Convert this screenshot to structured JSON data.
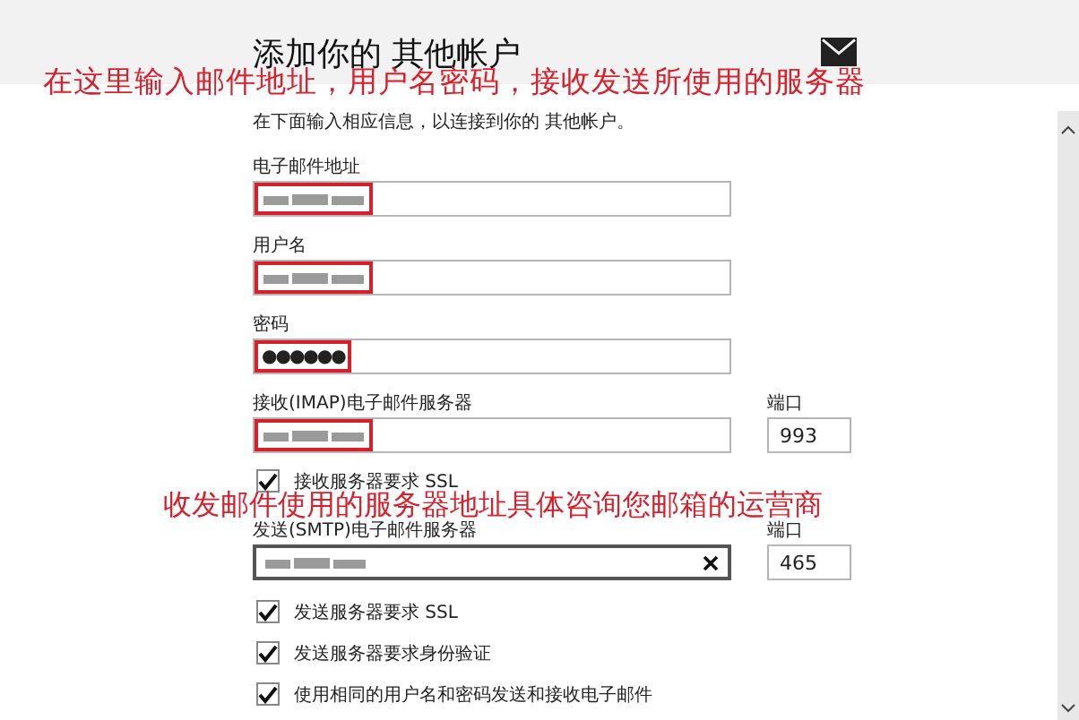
{
  "header": {
    "title": "添加你的 其他帐户"
  },
  "annotations": [
    "在这里输入邮件地址，用户名密码，接收发送所使用的服务器",
    "收发邮件使用的服务器地址具体咨询您邮箱的运营商"
  ],
  "intro": "在下面输入相应信息，以连接到你的 其他帐户。",
  "rows": [
    {
      "kind": "field",
      "label": "电子邮件地址",
      "blurred": true,
      "highlighted": true
    },
    {
      "kind": "field",
      "label": "用户名",
      "blurred": true,
      "highlighted": true
    },
    {
      "kind": "field",
      "label": "密码",
      "value": "●●●●●●",
      "highlighted": true
    },
    {
      "kind": "server",
      "label": "接收(IMAP)电子邮件服务器",
      "blurred": true,
      "highlighted": true,
      "focused": false,
      "clear_button": false,
      "port_label": "端口",
      "port": "993"
    },
    {
      "kind": "checkbox",
      "label": "接收服务器要求 SSL",
      "checked": true
    },
    {
      "kind": "server",
      "label": "发送(SMTP)电子邮件服务器",
      "blurred": true,
      "highlighted": false,
      "focused": true,
      "clear_button": true,
      "port_label": "端口",
      "port": "465"
    },
    {
      "kind": "checkbox",
      "label": "发送服务器要求 SSL",
      "checked": true
    },
    {
      "kind": "checkbox",
      "label": "发送服务器要求身份验证",
      "checked": true
    },
    {
      "kind": "checkbox",
      "label": "使用相同的用户名和密码发送和接收电子邮件",
      "checked": true
    }
  ]
}
